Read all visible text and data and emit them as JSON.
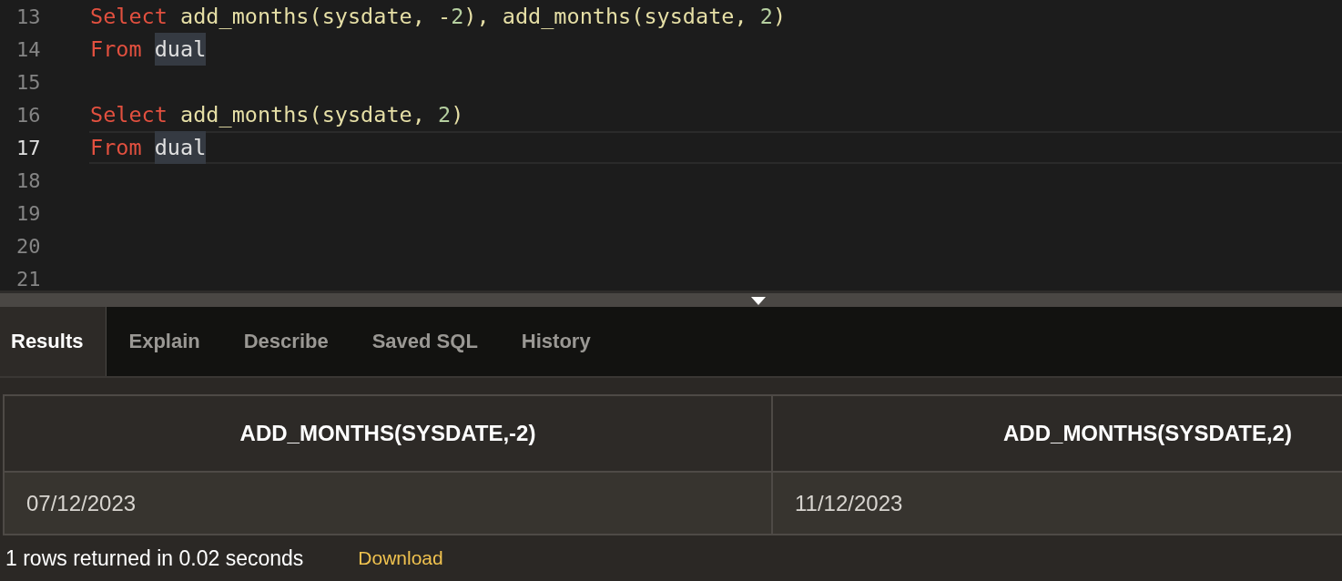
{
  "editor": {
    "lines": [
      {
        "number": "13",
        "current": false,
        "tokens": [
          {
            "text": "Select",
            "kind": "keyword"
          },
          {
            "text": " add_months(sysdate, -",
            "kind": "text"
          },
          {
            "text": "2",
            "kind": "number"
          },
          {
            "text": "), add_months(sysdate, ",
            "kind": "text"
          },
          {
            "text": "2",
            "kind": "number"
          },
          {
            "text": ")",
            "kind": "text"
          }
        ]
      },
      {
        "number": "14",
        "current": false,
        "tokens": [
          {
            "text": "From",
            "kind": "keyword"
          },
          {
            "text": "dual",
            "kind": "match"
          }
        ]
      },
      {
        "number": "15",
        "current": false
      },
      {
        "number": "16",
        "current": false,
        "tokens": [
          {
            "text": "Select",
            "kind": "keyword"
          },
          {
            "text": " add_months(sysdate, ",
            "kind": "text"
          },
          {
            "text": "2",
            "kind": "number"
          },
          {
            "text": ")",
            "kind": "text"
          }
        ]
      },
      {
        "number": "17",
        "current": true,
        "tokens": [
          {
            "text": "From",
            "kind": "keyword"
          },
          {
            "text": "dual",
            "kind": "match"
          }
        ]
      },
      {
        "number": "18",
        "current": false
      },
      {
        "number": "19",
        "current": false
      },
      {
        "number": "20",
        "current": false
      },
      {
        "number": "21",
        "current": false
      }
    ]
  },
  "tabs": [
    {
      "label": "Results",
      "selected": true
    },
    {
      "label": "Explain",
      "selected": false
    },
    {
      "label": "Describe",
      "selected": false
    },
    {
      "label": "Saved SQL",
      "selected": false
    },
    {
      "label": "History",
      "selected": false
    }
  ],
  "table": {
    "columns": [
      "ADD_MONTHS(SYSDATE,-2)",
      "ADD_MONTHS(SYSDATE,2)"
    ],
    "rows": [
      [
        "07/12/2023",
        "11/12/2023"
      ]
    ]
  },
  "status": {
    "message": "1 rows returned in 0.02 seconds",
    "link": "Download"
  }
}
